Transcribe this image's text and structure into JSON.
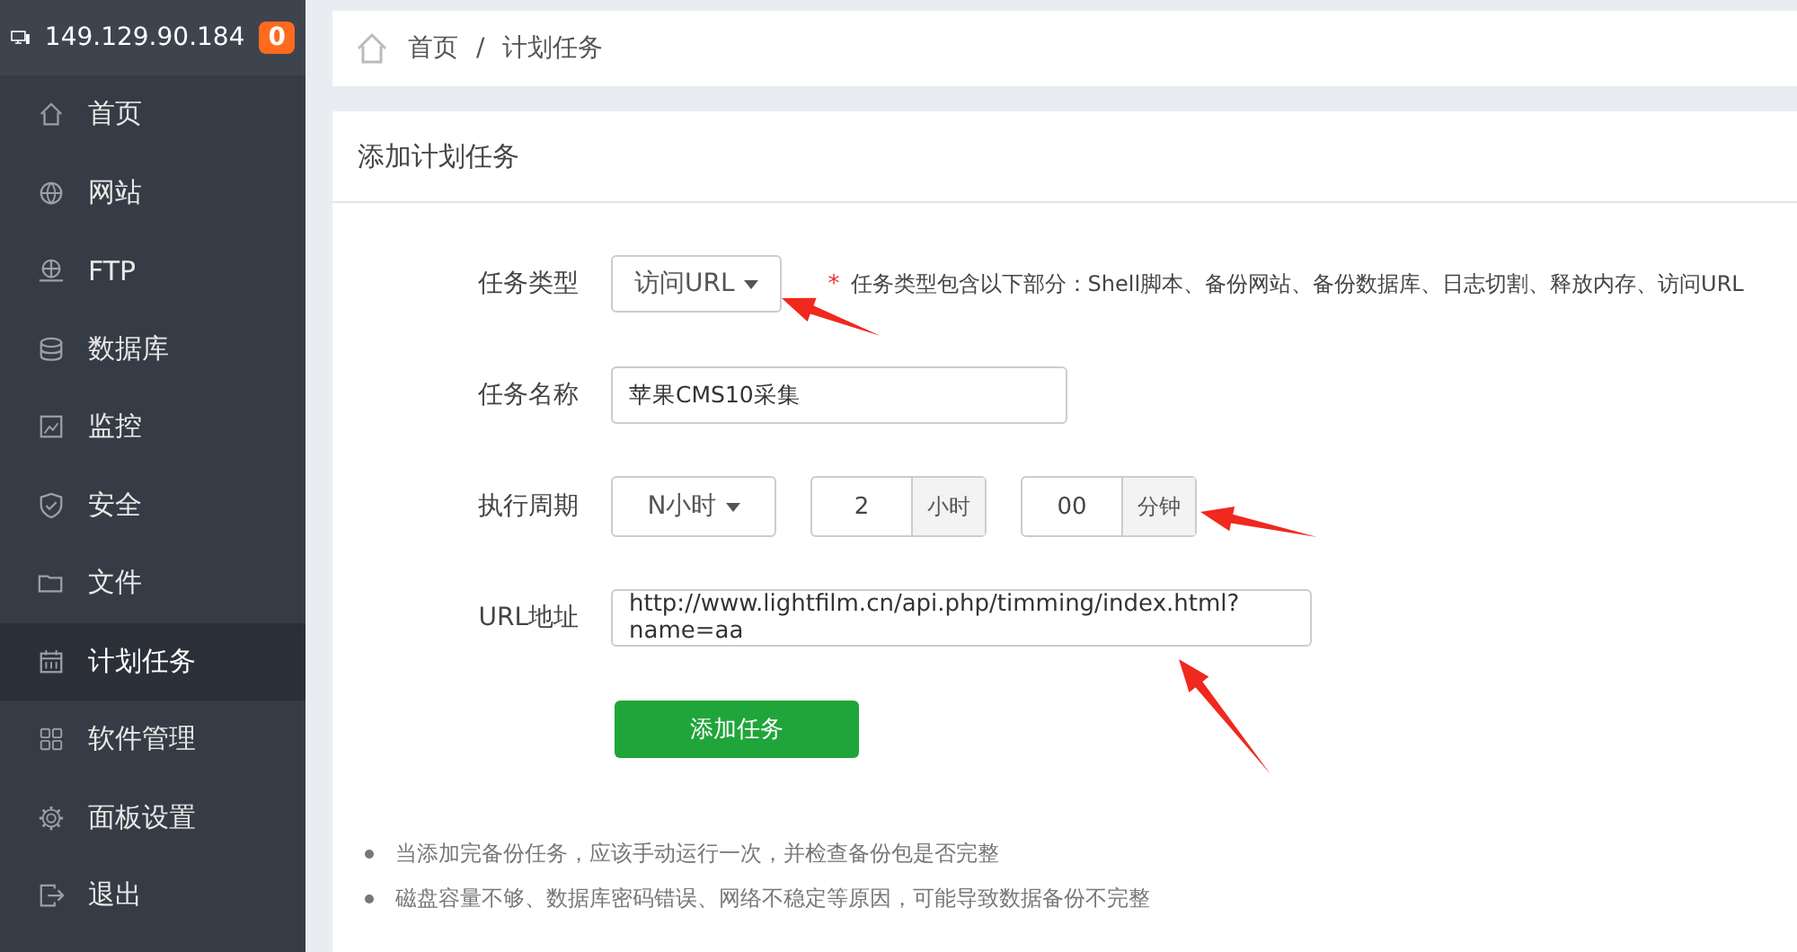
{
  "server": {
    "ip": "149.129.90.184",
    "badge": "0"
  },
  "sidebar": {
    "items": [
      {
        "label": "首页",
        "kind": "home",
        "selected": false
      },
      {
        "label": "网站",
        "kind": "globe",
        "selected": false
      },
      {
        "label": "FTP",
        "kind": "ftp",
        "selected": false
      },
      {
        "label": "数据库",
        "kind": "database",
        "selected": false
      },
      {
        "label": "监控",
        "kind": "monitor",
        "selected": false
      },
      {
        "label": "安全",
        "kind": "shield",
        "selected": false
      },
      {
        "label": "文件",
        "kind": "folder",
        "selected": false
      },
      {
        "label": "计划任务",
        "kind": "calendar",
        "selected": true
      },
      {
        "label": "软件管理",
        "kind": "grid",
        "selected": false
      },
      {
        "label": "面板设置",
        "kind": "gear",
        "selected": false
      },
      {
        "label": "退出",
        "kind": "exit",
        "selected": false
      }
    ]
  },
  "breadcrumb": {
    "items": [
      "首页",
      "计划任务"
    ],
    "separator": "/"
  },
  "form": {
    "title": "添加计划任务",
    "task_type": {
      "label": "任务类型",
      "value": "访问URL",
      "required_mark": "*",
      "note": "任务类型包含以下部分：Shell脚本、备份网站、备份数据库、日志切割、释放内存、访问URL"
    },
    "task_name": {
      "label": "任务名称",
      "value": "苹果CMS10采集"
    },
    "period": {
      "label": "执行周期",
      "mode": "N小时",
      "hours": "2",
      "hours_unit": "小时",
      "minutes": "00",
      "minutes_unit": "分钟"
    },
    "url": {
      "label": "URL地址",
      "value": "http://www.lightfilm.cn/api.php/timming/index.html?name=aa"
    },
    "submit_button": "添加任务"
  },
  "notes": [
    "当添加完备份任务，应该手动运行一次，并检查备份包是否完整",
    "磁盘容量不够、数据库密码错误、网络不稳定等原因，可能导致数据备份不完整"
  ]
}
